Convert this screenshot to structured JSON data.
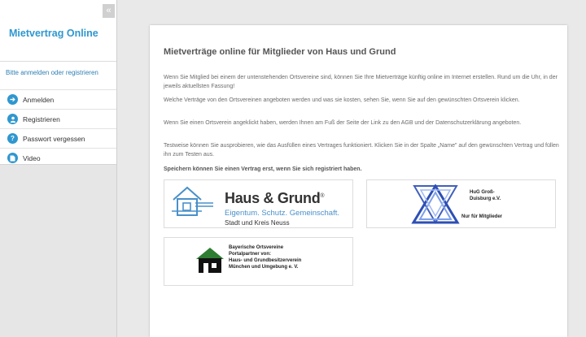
{
  "sidebar": {
    "brand": "Mietvertrag Online",
    "collapse_glyph": "«",
    "login_prompt": "Bitte anmelden oder registrieren",
    "items": [
      {
        "label": "Anmelden",
        "icon": "login-icon"
      },
      {
        "label": "Registrieren",
        "icon": "user-icon"
      },
      {
        "label": "Passwort vergessen",
        "icon": "question-icon"
      },
      {
        "label": "Video",
        "icon": "document-icon"
      }
    ]
  },
  "main": {
    "title": "Mietverträge online für Mitglieder von Haus und Grund",
    "paragraphs": [
      "Wenn Sie Mitglied bei einem der untenstehenden Ortsvereine sind, können Sie Ihre Mietverträge künftig online im Internet erstellen. Rund um die Uhr, in der jeweils aktuellsten Fassung!",
      "Welche Verträge von den Ortsvereinen angeboten werden und was sie kosten, sehen Sie, wenn Sie auf den gewünschten Ortsverein klicken.",
      "Wenn Sie einen Ortsverein angeklickt haben, werden Ihnen am Fuß der Seite der Link zu den AGB und der Datenschutzerklärung angeboten.",
      "Testweise können Sie ausprobieren, wie das Ausfüllen eines Vertrages funktioniert. Klicken Sie in der Spalte „Name\" auf den gewünschten Vertrag und füllen ihn zum Testen aus."
    ],
    "bold_note": "Speichern können Sie einen Vertrag erst, wenn Sie sich registriert haben.",
    "associations": [
      {
        "name": "Haus & Grund",
        "registered": "®",
        "tagline": "Eigentum. Schutz. Gemeinschaft.",
        "sub": "Stadt und Kreis Neuss"
      },
      {
        "line1": "HuG Groß-",
        "line2": "Duisburg e.V.",
        "note": "Nur für Mitglieder"
      },
      {
        "lines": [
          "Bayerische Ortsvereine",
          "Portalpartner von:",
          "Haus- und Grundbesitzerverein",
          "München und Umgebung e. V."
        ]
      }
    ]
  },
  "colors": {
    "accent": "#2f97cf",
    "sidebar_bg": "#e6e6e6",
    "page_bg": "#e9e9e9",
    "logo_blue": "#4a90c9",
    "duisburg_blue": "#2d4fb5",
    "munich_green": "#2e7d32"
  }
}
